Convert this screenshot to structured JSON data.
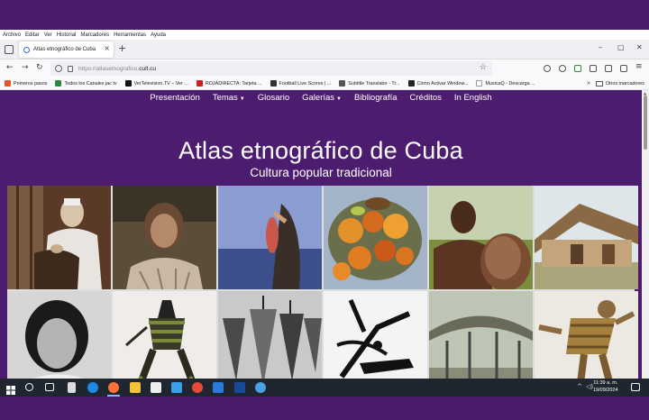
{
  "menubar": [
    "Archivo",
    "Editar",
    "Ver",
    "Historial",
    "Marcadores",
    "Herramientas",
    "Ayuda"
  ],
  "tab": {
    "title": "Atlas etnográfico de Cuba",
    "close": "×"
  },
  "newtab": "+",
  "window_controls": [
    "–",
    "▢",
    "✕"
  ],
  "url": {
    "prefix": "https://atlasetnografico.",
    "domain": "cult.cu"
  },
  "bookmarks": [
    {
      "label": "Primeros pasos",
      "color": "#e8552b"
    },
    {
      "label": "Todos los Canales jac tv",
      "color": "#2a8a3a"
    },
    {
      "label": "VerTelevision.TV – Ver ...",
      "color": "#111111"
    },
    {
      "label": "ROJADIRECTA: Tarjeta ...",
      "color": "#cc1f1f"
    },
    {
      "label": "Football Live Scores | ...",
      "color": "#333333"
    },
    {
      "label": "Subtitle Translator - Tr...",
      "color": "#555555"
    },
    {
      "label": "Cómo Activar Window...",
      "color": "#222222"
    },
    {
      "label": "MusicaQ - Descarga ...",
      "color": "#ffffff"
    }
  ],
  "bookmarks_more": "»",
  "other_bookmarks": "Otros marcadores",
  "site": {
    "nav": [
      {
        "label": "Presentación",
        "dropdown": false
      },
      {
        "label": "Temas",
        "dropdown": true
      },
      {
        "label": "Glosario",
        "dropdown": false
      },
      {
        "label": "Galerías",
        "dropdown": true
      },
      {
        "label": "Bibliografía",
        "dropdown": false
      },
      {
        "label": "Créditos",
        "dropdown": false
      },
      {
        "label": "In English",
        "dropdown": false
      }
    ],
    "title": "Atlas etnográfico de Cuba",
    "subtitle": "Cultura popular tradicional"
  },
  "clock": {
    "time": "11:39 a. m.",
    "date": "19/09/2024"
  },
  "colors": {
    "page_bg": "#4c1c6e",
    "outer_bg": "#4a1a6b",
    "taskbar": "#1f2630"
  }
}
